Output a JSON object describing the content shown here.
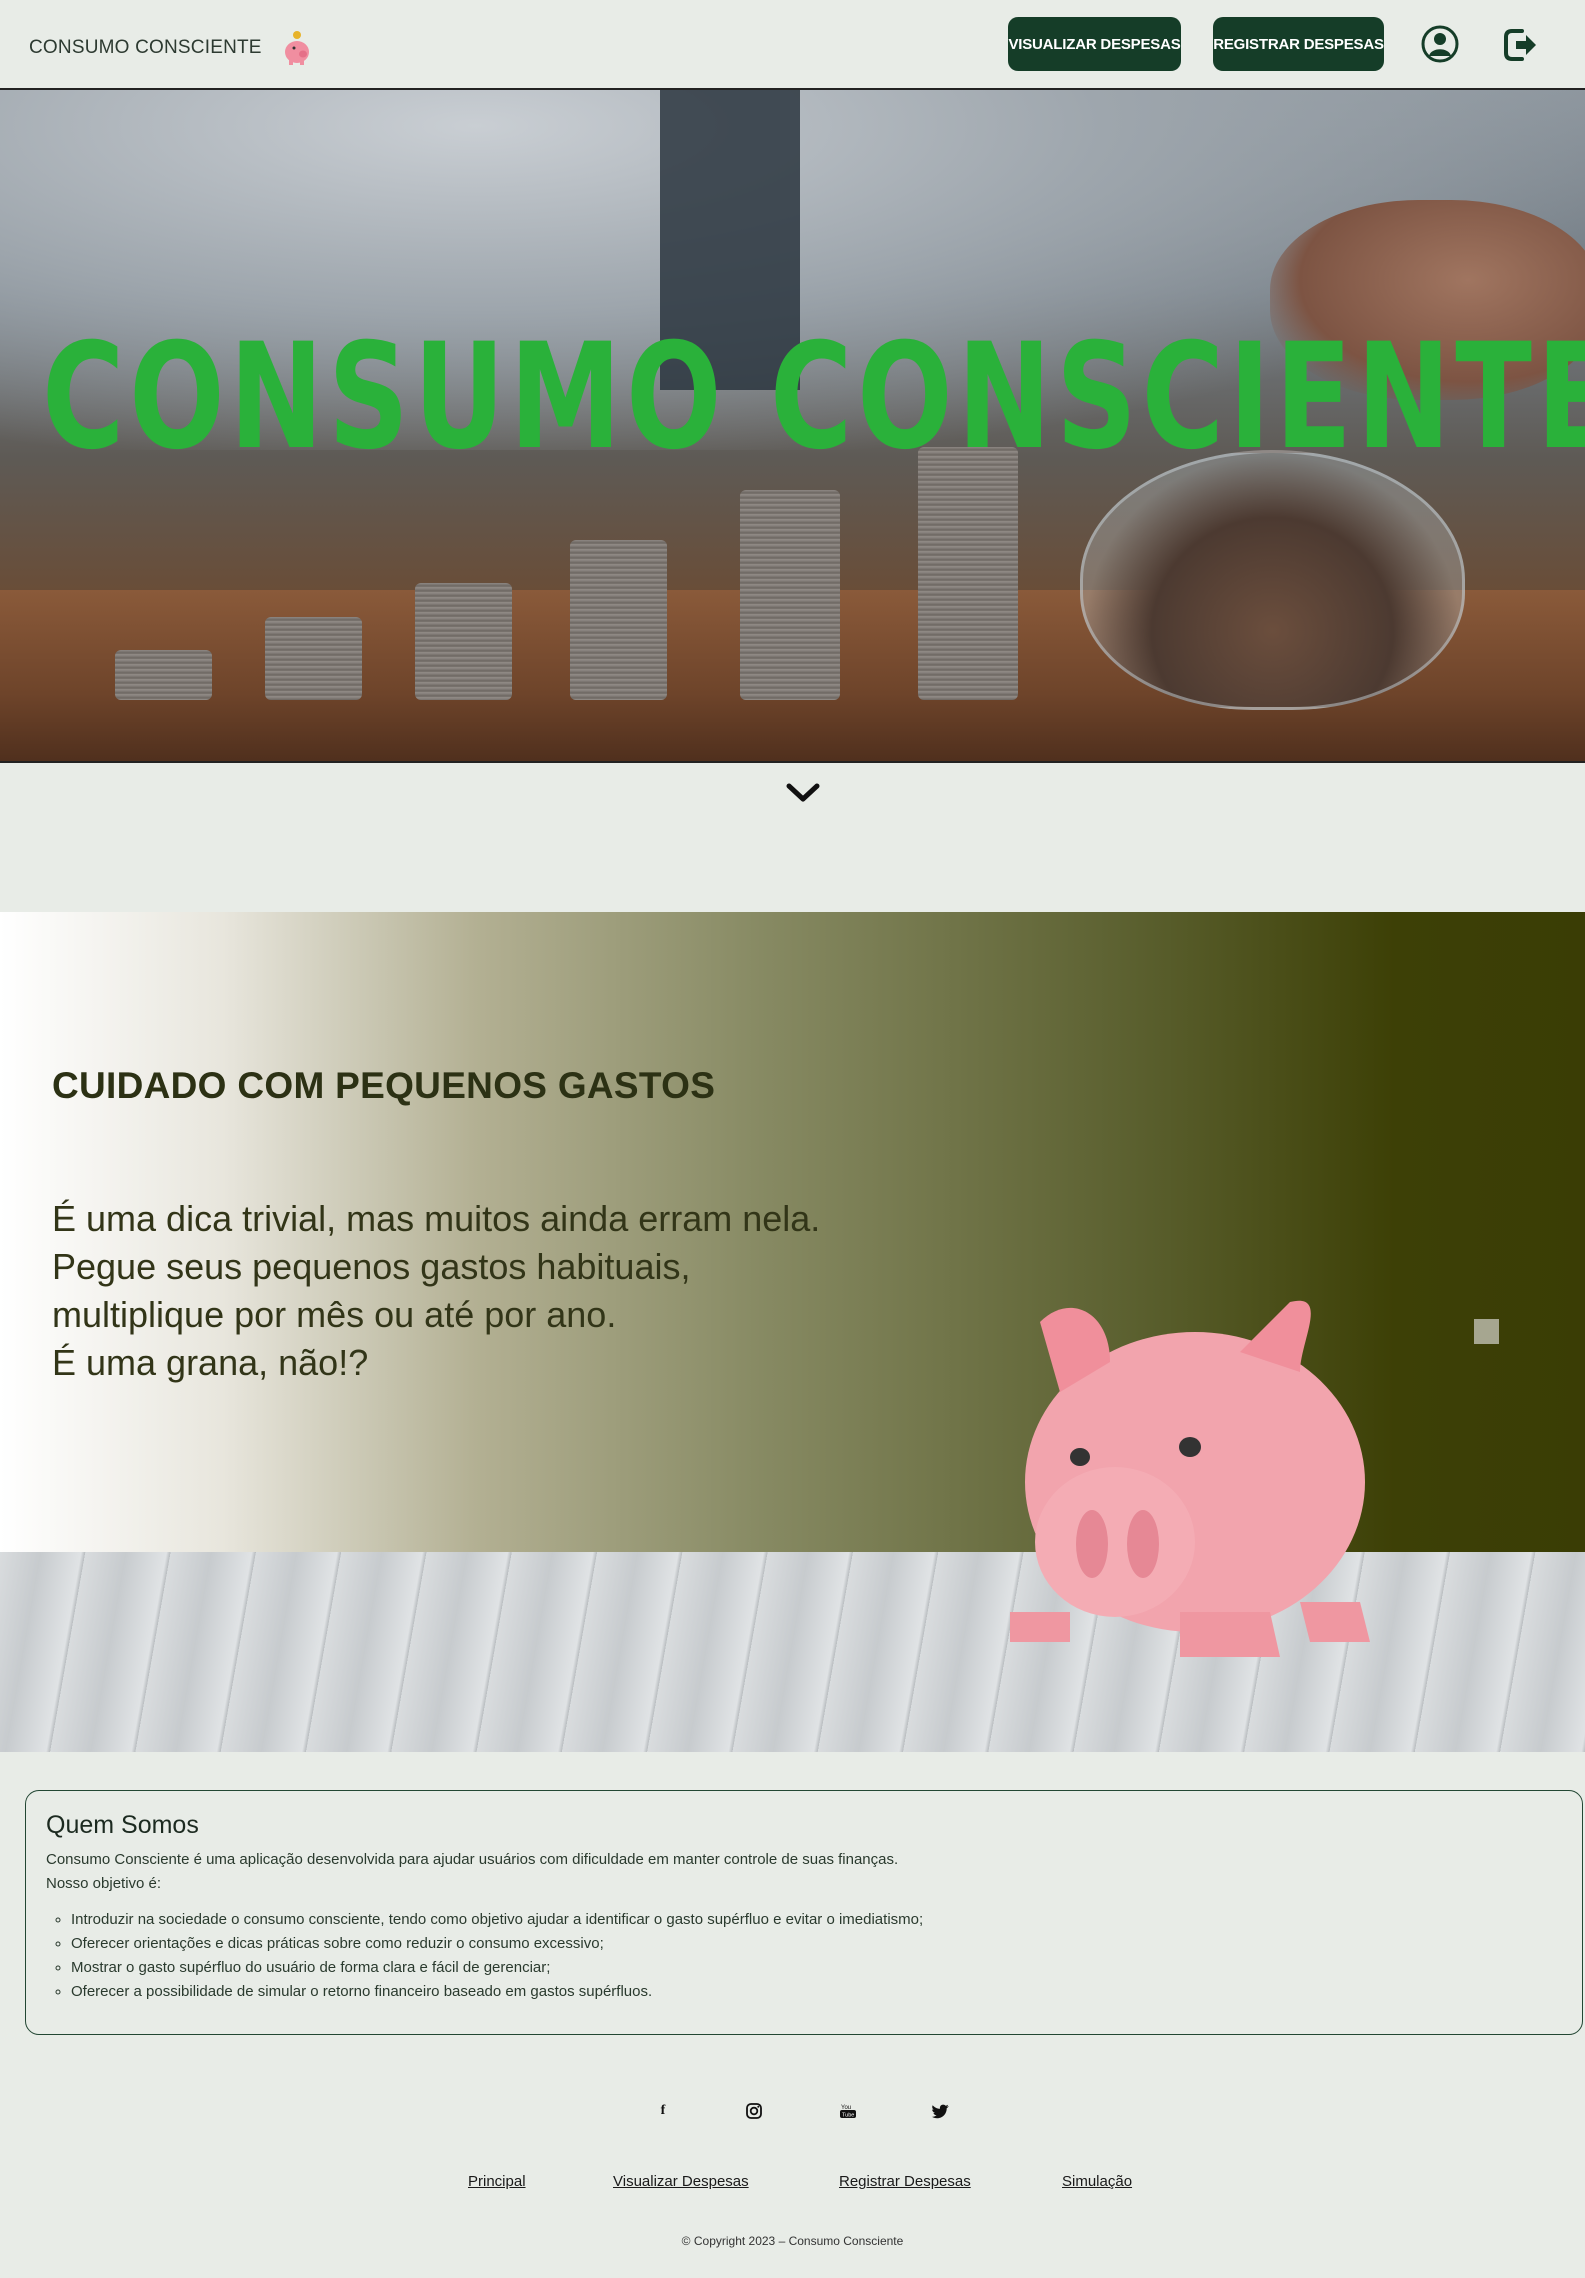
{
  "header": {
    "brand": "CONSUMO CONSCIENTE",
    "brand_icon": "piggy-bank-icon",
    "view_button": "VISUALIZAR DESPESAS",
    "register_button": "REGISTRAR DESPESAS",
    "user_icon": "user-circle-icon",
    "logout_icon": "logout-icon"
  },
  "hero": {
    "title": "CONSUMO CONSCIENTE",
    "scroll_icon": "chevron-down-icon"
  },
  "banner": {
    "title": "CUIDADO COM PEQUENOS GASTOS",
    "lines": [
      "É uma dica trivial, mas muitos ainda erram nela.",
      "Pegue seus pequenos gastos habituais,",
      "multiplique por mês ou até por ano.",
      "É uma grana, não!?"
    ]
  },
  "about": {
    "title": "Quem Somos",
    "description": "Consumo Consciente é uma aplicação desenvolvida para ajudar usuários com dificuldade em manter controle de suas finanças.",
    "objective_label": "Nosso objetivo é:",
    "objectives": [
      "Introduzir na sociedade o consumo consciente, tendo como objetivo ajudar a identificar o gasto supérfluo e evitar o imediatismo;",
      "Oferecer orientações e dicas práticas sobre como reduzir o consumo excessivo;",
      "Mostrar o gasto supérfluo do usuário de forma clara e fácil de gerenciar;",
      "Oferecer a possibilidade de simular o retorno financeiro baseado em gastos supérfluos."
    ]
  },
  "footer": {
    "social": {
      "facebook": "f",
      "instagram": "◎",
      "youtube": "▶",
      "twitter": "🐦"
    },
    "links": [
      "Principal",
      "Visualizar Despesas",
      "Registrar Despesas",
      "Simulação"
    ],
    "copyright": "© Copyright 2023 – Consumo Consciente"
  },
  "colors": {
    "background": "#e8ece7",
    "button": "#153d28",
    "hero_title": "#2ab13a",
    "banner_dark": "#3d4006"
  }
}
